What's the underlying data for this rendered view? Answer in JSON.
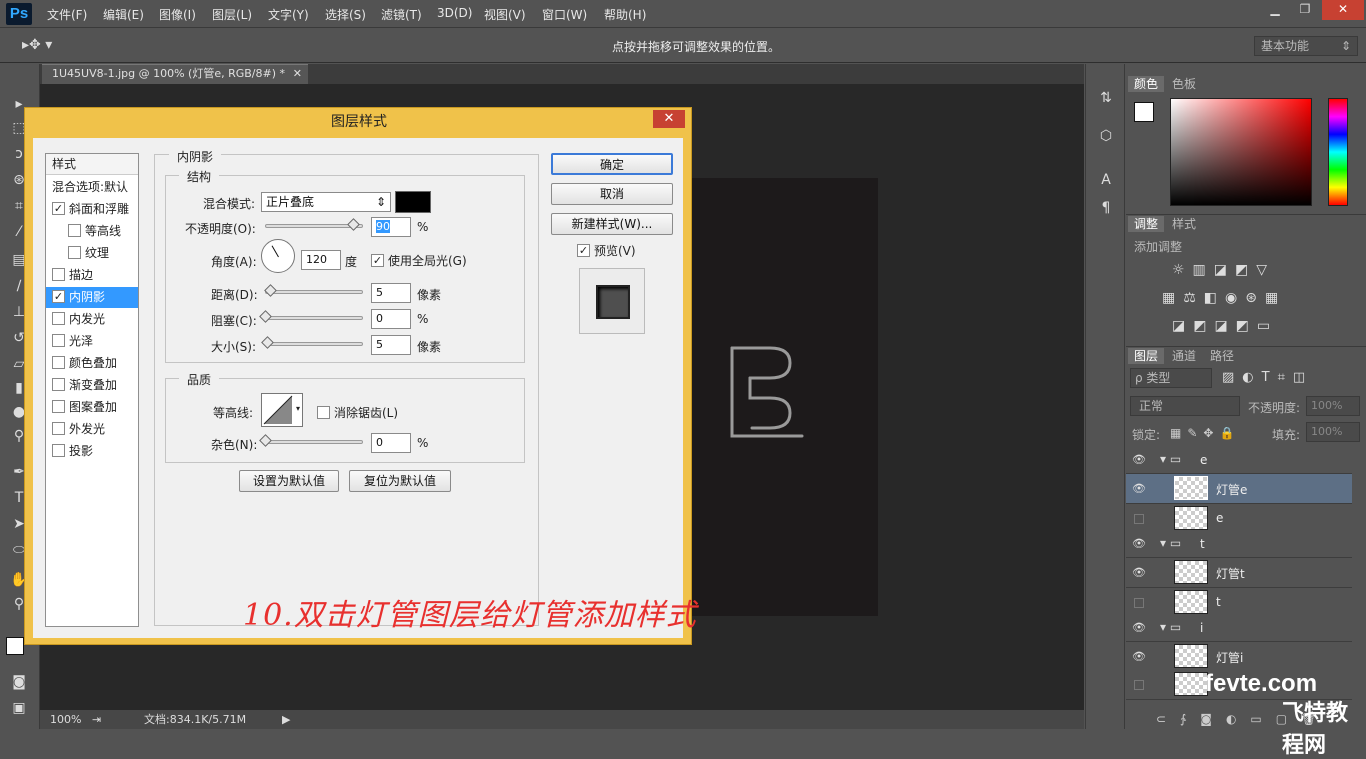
{
  "app": {
    "logo": "Ps"
  },
  "menu": [
    "文件(F)",
    "编辑(E)",
    "图像(I)",
    "图层(L)",
    "文字(Y)",
    "选择(S)",
    "滤镜(T)",
    "3D(D)",
    "视图(V)",
    "窗口(W)",
    "帮助(H)"
  ],
  "options": {
    "hint": "点按并拖移可调整效果的位置。",
    "workspace": "基本功能"
  },
  "document": {
    "tab": "1U45UV8-1.jpg @ 100% (灯管e, RGB/8#) *"
  },
  "status": {
    "zoom": "100%",
    "doc": "文档:834.1K/5.71M"
  },
  "dialog": {
    "title": "图层样式",
    "styles_header": "样式",
    "styles": [
      {
        "label": "混合选项:默认",
        "checkbox": false,
        "checked": false,
        "indent": false
      },
      {
        "label": "斜面和浮雕",
        "checkbox": true,
        "checked": true,
        "indent": false
      },
      {
        "label": "等高线",
        "checkbox": true,
        "checked": false,
        "indent": true
      },
      {
        "label": "纹理",
        "checkbox": true,
        "checked": false,
        "indent": true
      },
      {
        "label": "描边",
        "checkbox": true,
        "checked": false,
        "indent": false
      },
      {
        "label": "内阴影",
        "checkbox": true,
        "checked": true,
        "indent": false,
        "selected": true
      },
      {
        "label": "内发光",
        "checkbox": true,
        "checked": false,
        "indent": false
      },
      {
        "label": "光泽",
        "checkbox": true,
        "checked": false,
        "indent": false
      },
      {
        "label": "颜色叠加",
        "checkbox": true,
        "checked": false,
        "indent": false
      },
      {
        "label": "渐变叠加",
        "checkbox": true,
        "checked": false,
        "indent": false
      },
      {
        "label": "图案叠加",
        "checkbox": true,
        "checked": false,
        "indent": false
      },
      {
        "label": "外发光",
        "checkbox": true,
        "checked": false,
        "indent": false
      },
      {
        "label": "投影",
        "checkbox": true,
        "checked": false,
        "indent": false
      }
    ],
    "section_title": "内阴影",
    "structure": {
      "title": "结构",
      "blend_label": "混合模式:",
      "blend_value": "正片叠底",
      "blend_color": "#000000",
      "opacity_label": "不透明度(O):",
      "opacity_value": "90",
      "opacity_unit": "%",
      "angle_label": "角度(A):",
      "angle_value": "120",
      "angle_unit": "度",
      "global_light_label": "使用全局光(G)",
      "global_light_checked": true,
      "distance_label": "距离(D):",
      "distance_value": "5",
      "distance_unit": "像素",
      "choke_label": "阻塞(C):",
      "choke_value": "0",
      "choke_unit": "%",
      "size_label": "大小(S):",
      "size_value": "5",
      "size_unit": "像素"
    },
    "quality": {
      "title": "品质",
      "contour_label": "等高线:",
      "antialias_label": "消除锯齿(L)",
      "noise_label": "杂色(N):",
      "noise_value": "0",
      "noise_unit": "%"
    },
    "set_default": "设置为默认值",
    "reset_default": "复位为默认值",
    "ok": "确定",
    "cancel": "取消",
    "new_style": "新建样式(W)...",
    "preview_label": "预览(V)",
    "preview_checked": true
  },
  "annotation": "10.双击灯管图层给灯管添加样式",
  "panels": {
    "color_tabs": [
      "颜色",
      "色板"
    ],
    "adjust_tabs": [
      "调整",
      "样式"
    ],
    "adjust_title": "添加调整",
    "layer_tabs": [
      "图层",
      "通道",
      "路径"
    ],
    "filter_kind": "ρ 类型",
    "blend_mode": "正常",
    "opacity_label": "不透明度:",
    "opacity_value": "100%",
    "lock_label": "锁定:",
    "fill_label": "填充:",
    "fill_value": "100%"
  },
  "layers": [
    {
      "name": "e",
      "group": true,
      "visible": true,
      "selected": false
    },
    {
      "name": "灯管e",
      "group": false,
      "visible": true,
      "selected": true
    },
    {
      "name": "e",
      "group": false,
      "visible": false,
      "selected": false
    },
    {
      "name": "t",
      "group": true,
      "visible": true,
      "selected": false
    },
    {
      "name": "灯管t",
      "group": false,
      "visible": true,
      "selected": false
    },
    {
      "name": "t",
      "group": false,
      "visible": false,
      "selected": false
    },
    {
      "name": "i",
      "group": true,
      "visible": true,
      "selected": false
    },
    {
      "name": "灯管i",
      "group": false,
      "visible": true,
      "selected": false
    },
    {
      "name": "i",
      "group": false,
      "visible": false,
      "selected": false
    }
  ],
  "watermark": {
    "line1": "fevte.com",
    "line2": "飞特教程网"
  }
}
